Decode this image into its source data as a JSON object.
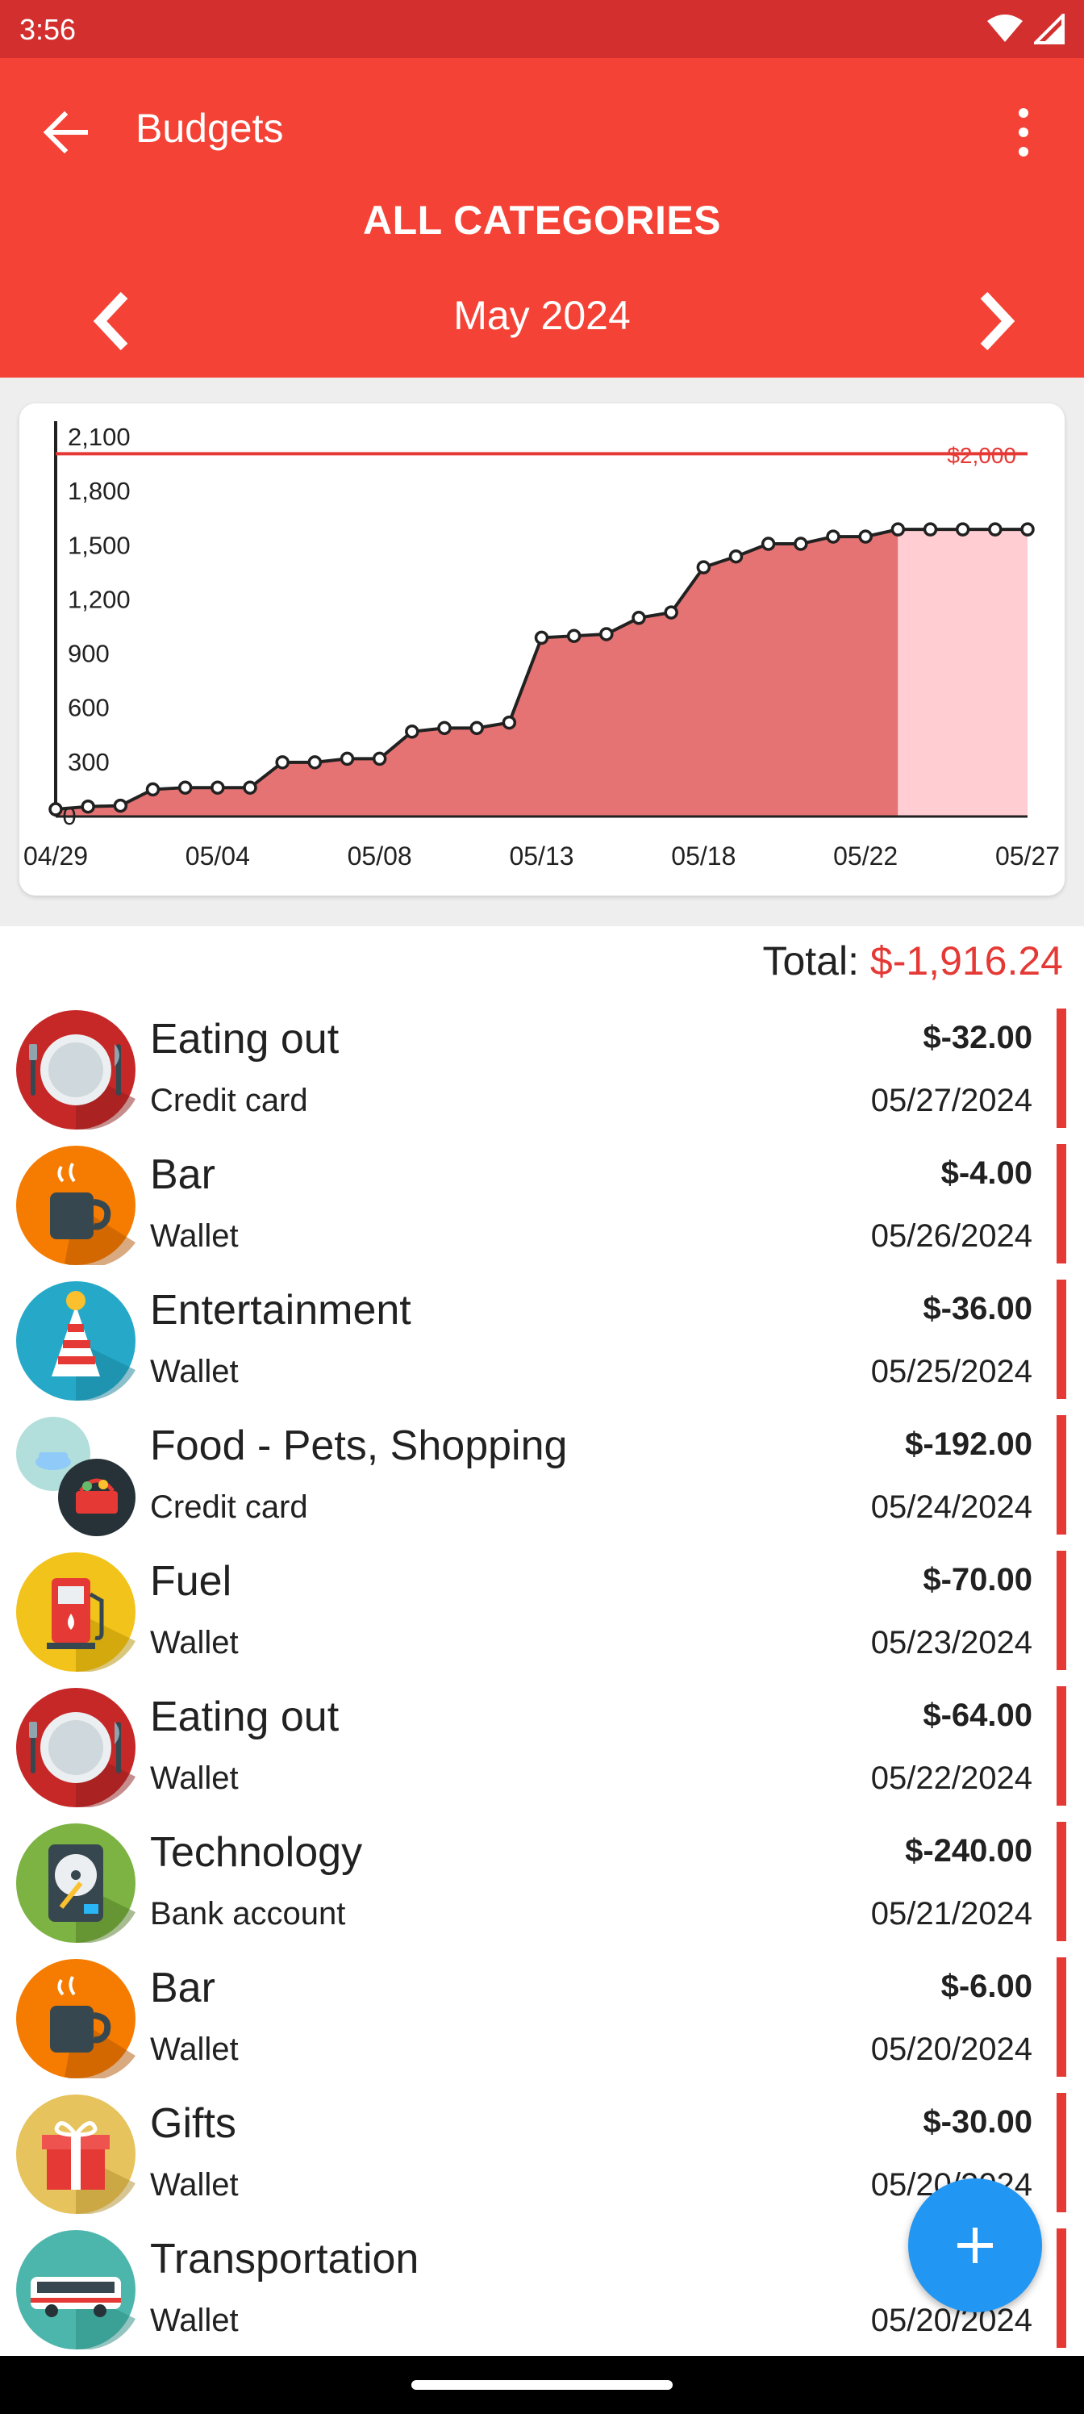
{
  "status_bar": {
    "time": "3:56"
  },
  "app_bar": {
    "title": "Budgets",
    "category": "ALL CATEGORIES",
    "month": "May 2024",
    "back_icon": "arrow-left-icon",
    "menu_icon": "more-vertical-icon"
  },
  "chart_data": {
    "type": "area",
    "budget_label": "$2,000",
    "budget_value": 2000,
    "ylim": [
      0,
      2100
    ],
    "y_ticks": [
      {
        "v": 2100,
        "t": "2,100"
      },
      {
        "v": 1800,
        "t": "1,800"
      },
      {
        "v": 1500,
        "t": "1,500"
      },
      {
        "v": 1200,
        "t": "1,200"
      },
      {
        "v": 900,
        "t": "900"
      },
      {
        "v": 600,
        "t": "600"
      },
      {
        "v": 300,
        "t": "300"
      },
      {
        "v": 0,
        "t": "0"
      }
    ],
    "x_tick_labels": [
      {
        "d": 0,
        "t": "04/29"
      },
      {
        "d": 5,
        "t": "05/04"
      },
      {
        "d": 10,
        "t": "05/08"
      },
      {
        "d": 15,
        "t": "05/13"
      },
      {
        "d": 20,
        "t": "05/18"
      },
      {
        "d": 25,
        "t": "05/22"
      },
      {
        "d": 30,
        "t": "05/27"
      }
    ],
    "points": [
      {
        "d": 0,
        "y": 40
      },
      {
        "d": 1,
        "y": 55
      },
      {
        "d": 2,
        "y": 60
      },
      {
        "d": 3,
        "y": 150
      },
      {
        "d": 4,
        "y": 160
      },
      {
        "d": 5,
        "y": 160
      },
      {
        "d": 6,
        "y": 160
      },
      {
        "d": 7,
        "y": 300
      },
      {
        "d": 8,
        "y": 300
      },
      {
        "d": 9,
        "y": 320
      },
      {
        "d": 10,
        "y": 320
      },
      {
        "d": 11,
        "y": 470
      },
      {
        "d": 12,
        "y": 490
      },
      {
        "d": 13,
        "y": 490
      },
      {
        "d": 14,
        "y": 520
      },
      {
        "d": 15,
        "y": 990
      },
      {
        "d": 16,
        "y": 1000
      },
      {
        "d": 17,
        "y": 1010
      },
      {
        "d": 18,
        "y": 1100
      },
      {
        "d": 19,
        "y": 1130
      },
      {
        "d": 20,
        "y": 1380
      },
      {
        "d": 21,
        "y": 1440
      },
      {
        "d": 22,
        "y": 1510
      },
      {
        "d": 23,
        "y": 1510
      },
      {
        "d": 24,
        "y": 1550
      },
      {
        "d": 25,
        "y": 1550
      },
      {
        "d": 26,
        "y": 1590
      },
      {
        "d": 27,
        "y": 1590
      },
      {
        "d": 28,
        "y": 1590
      },
      {
        "d": 29,
        "y": 1590
      },
      {
        "d": 30,
        "y": 1590
      }
    ],
    "current_day": 26,
    "total_days": 30,
    "colors": {
      "area": "#e57373",
      "future_area": "#ffcdd2",
      "budget_line": "#e53935",
      "line": "#212121"
    }
  },
  "total": {
    "label": "Total:",
    "value": "$-1,916.24"
  },
  "transactions": [
    {
      "category": "Eating out",
      "account": "Credit card",
      "amount": "$-32.00",
      "date": "05/27/2024",
      "icon": "plate-cutlery-icon"
    },
    {
      "category": "Bar",
      "account": "Wallet",
      "amount": "$-4.00",
      "date": "05/26/2024",
      "icon": "coffee-cup-icon"
    },
    {
      "category": "Entertainment",
      "account": "Wallet",
      "amount": "$-36.00",
      "date": "05/25/2024",
      "icon": "party-hat-icon"
    },
    {
      "category": "Food - Pets, Shopping",
      "account": "Credit card",
      "amount": "$-192.00",
      "date": "05/24/2024",
      "icon": "pet-bowl-shopping-basket-icon"
    },
    {
      "category": "Fuel",
      "account": "Wallet",
      "amount": "$-70.00",
      "date": "05/23/2024",
      "icon": "fuel-pump-icon"
    },
    {
      "category": "Eating out",
      "account": "Wallet",
      "amount": "$-64.00",
      "date": "05/22/2024",
      "icon": "plate-cutlery-icon"
    },
    {
      "category": "Technology",
      "account": "Bank account",
      "amount": "$-240.00",
      "date": "05/21/2024",
      "icon": "hard-drive-icon"
    },
    {
      "category": "Bar",
      "account": "Wallet",
      "amount": "$-6.00",
      "date": "05/20/2024",
      "icon": "coffee-cup-icon"
    },
    {
      "category": "Gifts",
      "account": "Wallet",
      "amount": "$-30.00",
      "date": "05/20/2024",
      "icon": "gift-box-icon"
    },
    {
      "category": "Transportation",
      "account": "Wallet",
      "amount": "",
      "date": "05/20/2024",
      "icon": "bus-icon"
    }
  ],
  "fab": {
    "icon": "plus-icon"
  }
}
